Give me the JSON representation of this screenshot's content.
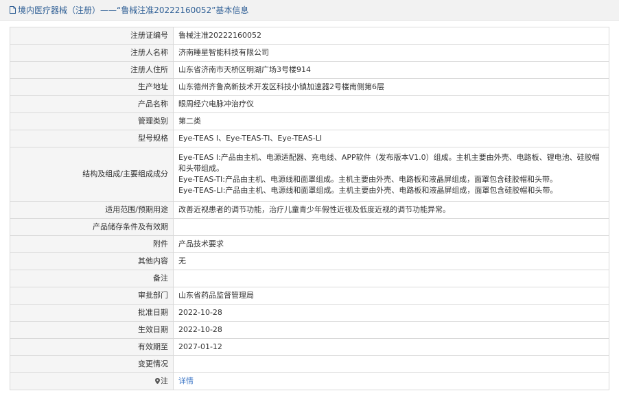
{
  "header": {
    "title": "境内医疗器械（注册）——“鲁械注准20222160052”基本信息"
  },
  "rows": [
    {
      "label": "注册证编号",
      "value": "鲁械注准20222160052"
    },
    {
      "label": "注册人名称",
      "value": "济南睡星智能科技有限公司"
    },
    {
      "label": "注册人住所",
      "value": "山东省济南市天桥区明湖广场3号楼914"
    },
    {
      "label": "生产地址",
      "value": "山东德州齐鲁高新技术开发区科技小镇加速器2号楼南侧第6层"
    },
    {
      "label": "产品名称",
      "value": "眼周经穴电脉冲治疗仪"
    },
    {
      "label": "管理类别",
      "value": "第二类"
    },
    {
      "label": "型号规格",
      "value": "Eye-TEAS Ⅰ、Eye-TEAS-TⅠ、Eye-TEAS-LⅠ"
    },
    {
      "label": "结构及组成/主要组成成分",
      "lines": [
        "Eye-TEAS Ⅰ:产品由主机、电源适配器、充电线、APP软件（发布版本V1.0）组成。主机主要由外壳、电路板、锂电池、硅胶帽和头带组成。",
        "Eye-TEAS-TⅠ:产品由主机、电源线和面罩组成。主机主要由外壳、电路板和液晶屏组成，面罩包含硅胶帽和头带。",
        "Eye-TEAS-LⅠ:产品由主机、电源线和面罩组成。主机主要由外壳、电路板和液晶屏组成，面罩包含硅胶帽和头带。"
      ]
    },
    {
      "label": "适用范围/预期用途",
      "value": "改善近视患者的调节功能，治疗儿童青少年假性近视及低度近视的调节功能异常。"
    },
    {
      "label": "产品储存条件及有效期",
      "value": ""
    },
    {
      "label": "附件",
      "value": "产品技术要求"
    },
    {
      "label": "其他内容",
      "value": "无"
    },
    {
      "label": "备注",
      "value": ""
    },
    {
      "label": "审批部门",
      "value": "山东省药品监督管理局"
    },
    {
      "label": "批准日期",
      "value": "2022-10-28"
    },
    {
      "label": "生效日期",
      "value": "2022-10-28"
    },
    {
      "label": "有效期至",
      "value": "2027-01-12"
    },
    {
      "label": "变更情况",
      "value": ""
    },
    {
      "label": "注",
      "value": "详情"
    }
  ],
  "colors": {
    "link": "#3f78c7",
    "header_text": "#2f5f95",
    "label_bg": "#f5f5f5",
    "border": "#d9d9d9"
  }
}
